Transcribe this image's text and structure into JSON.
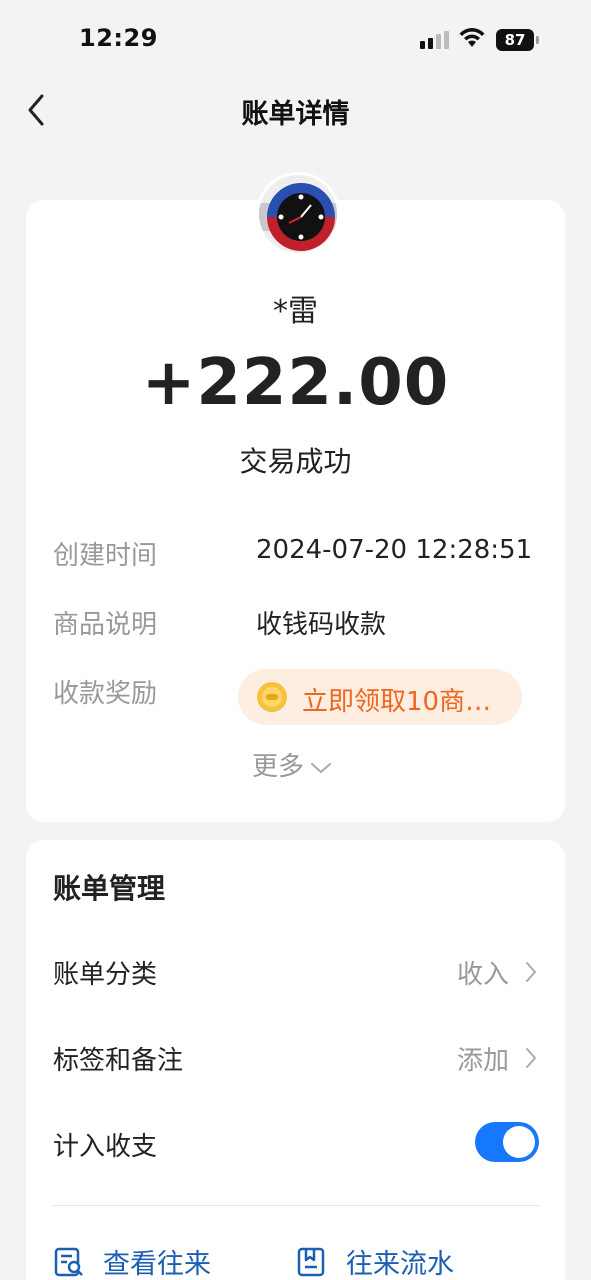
{
  "status_bar": {
    "time": "12:29",
    "battery": "87"
  },
  "nav": {
    "title": "账单详情"
  },
  "transaction": {
    "payer": "*雷",
    "amount": "+222.00",
    "status": "交易成功"
  },
  "details": {
    "created_label": "创建时间",
    "created_value": "2024-07-20 12:28:51",
    "product_label": "商品说明",
    "product_value": "收钱码收款",
    "reward_label": "收款奖励",
    "reward_value": "立即领取10商…",
    "more_label": "更多"
  },
  "manage": {
    "title": "账单管理",
    "category_label": "账单分类",
    "category_value": "收入",
    "tags_label": "标签和备注",
    "tags_value": "添加",
    "include_label": "计入收支",
    "include_on": true
  },
  "actions": {
    "view_contacts": "查看往来",
    "flow": "往来流水"
  },
  "colors": {
    "accent": "#1677ff",
    "reward_text": "#f0661c",
    "reward_bg": "#fdeee1"
  }
}
